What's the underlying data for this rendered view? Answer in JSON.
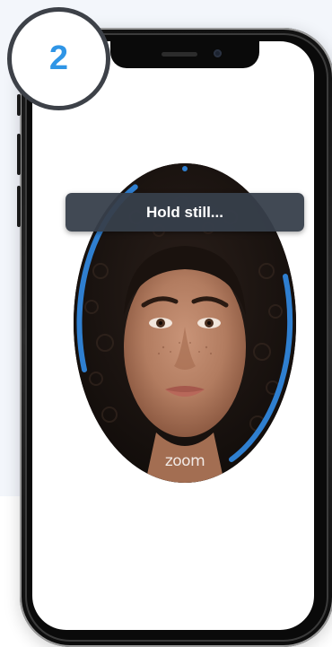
{
  "step": {
    "number": "2"
  },
  "screen": {
    "status_message": "Hold still...",
    "logo_text": "zoom"
  },
  "colors": {
    "accent": "#2f95e6",
    "ring": "#2f7fd0",
    "toast_bg": "#373f4b",
    "badge_border": "#3d4148",
    "background": "#f3f6fb"
  },
  "icons": {
    "front_camera": "camera-icon",
    "earpiece": "speaker-icon"
  }
}
